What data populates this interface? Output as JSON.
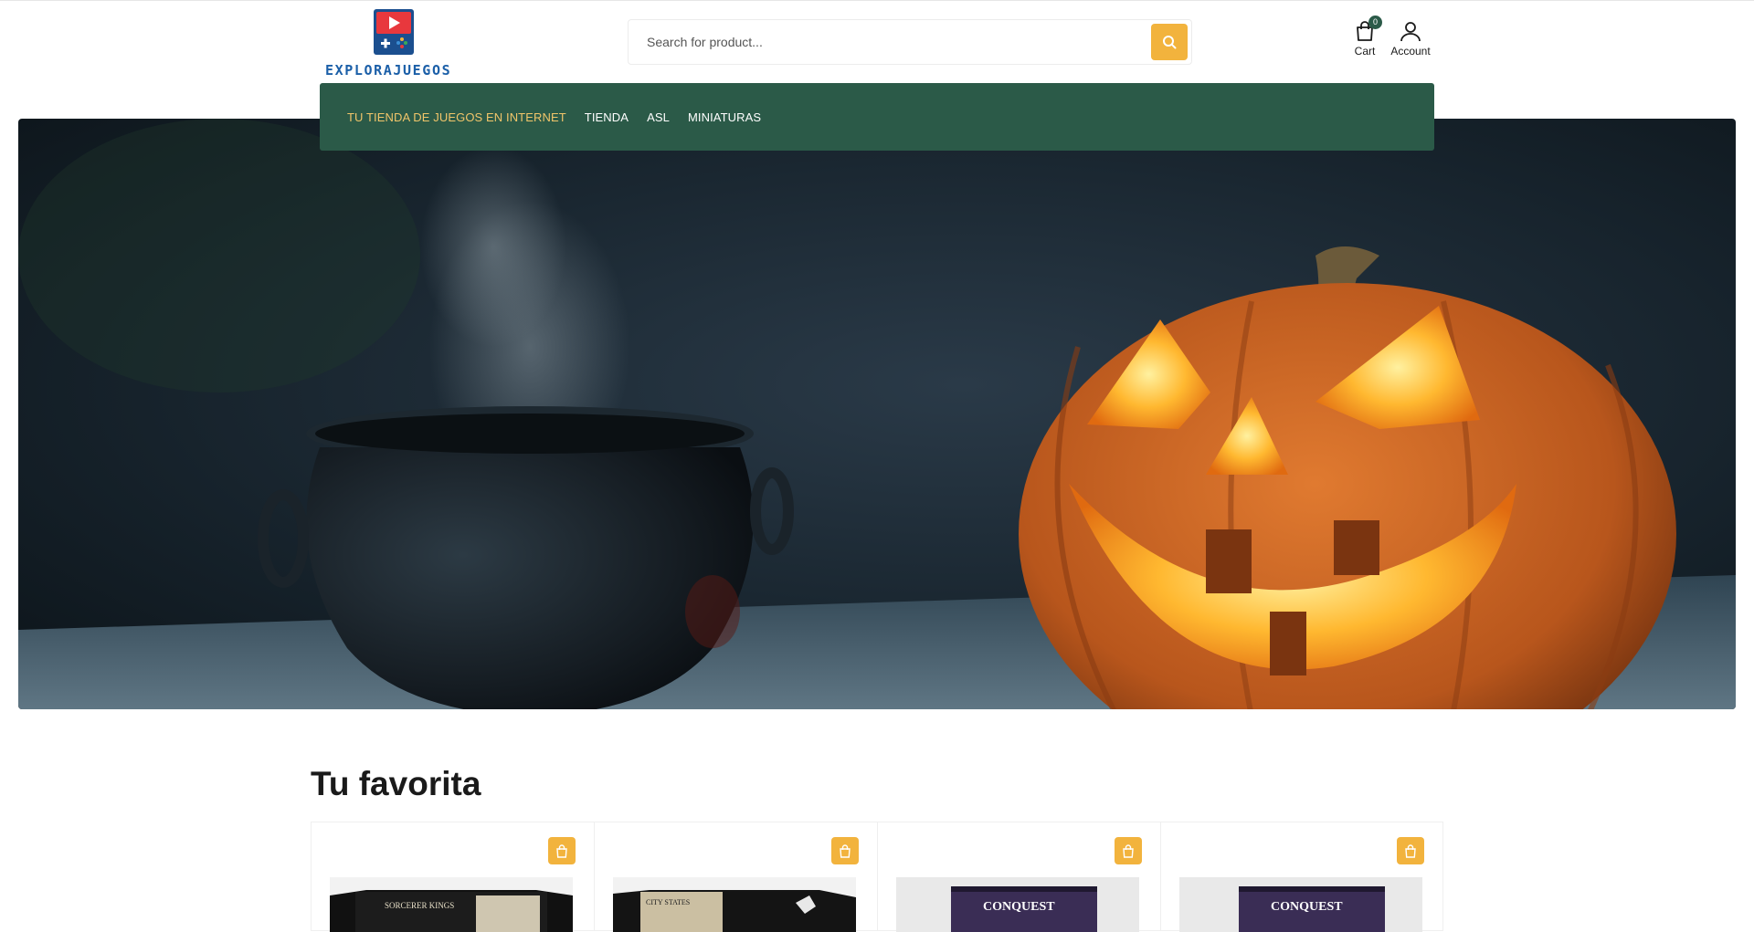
{
  "brand": {
    "name": "EXPLORAJUEGOS"
  },
  "search": {
    "placeholder": "Search for product..."
  },
  "header": {
    "cart_label": "Cart",
    "cart_count": "0",
    "account_label": "Account"
  },
  "nav": {
    "items": [
      {
        "label": "TU TIENDA DE JUEGOS EN INTERNET"
      },
      {
        "label": "TIENDA"
      },
      {
        "label": "ASL"
      },
      {
        "label": "MINIATURAS"
      }
    ]
  },
  "section": {
    "title": "Tu favorita"
  },
  "products": [
    {
      "box_text": "SORCERER KINGS"
    },
    {
      "box_text": "CITY STATES"
    },
    {
      "box_text": "CONQUEST"
    },
    {
      "box_text": "CONQUEST"
    }
  ],
  "colors": {
    "accent": "#f2b33d",
    "nav_bg": "#2b5a48",
    "nav_active": "#f0c56a",
    "brand_blue": "#1b5fa8",
    "logo_red": "#e8383d"
  }
}
